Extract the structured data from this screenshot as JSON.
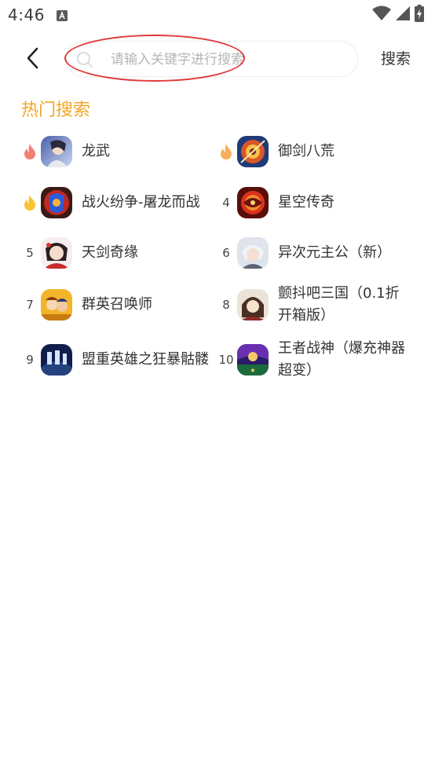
{
  "status": {
    "time": "4:46"
  },
  "search": {
    "placeholder": "请输入关键字进行搜索",
    "button_label": "搜索"
  },
  "hot_section": {
    "title": "热门搜索",
    "items": [
      {
        "rank": "",
        "rank_icon": "fire-icon-red",
        "name": "龙武"
      },
      {
        "rank": "",
        "rank_icon": "fire-icon-orange",
        "name": "御剑八荒"
      },
      {
        "rank": "",
        "rank_icon": "fire-icon-yellow",
        "name": "战火纷争-屠龙而战"
      },
      {
        "rank": "4",
        "rank_icon": "",
        "name": "星空传奇"
      },
      {
        "rank": "5",
        "rank_icon": "",
        "name": "天剑奇缘"
      },
      {
        "rank": "6",
        "rank_icon": "",
        "name": "异次元主公（新）"
      },
      {
        "rank": "7",
        "rank_icon": "",
        "name": "群英召唤师"
      },
      {
        "rank": "8",
        "rank_icon": "",
        "name": "颤抖吧三国（0.1折开箱版）"
      },
      {
        "rank": "9",
        "rank_icon": "",
        "name": "盟重英雄之狂暴骷髅"
      },
      {
        "rank": "10",
        "rank_icon": "",
        "name": "王者战神（爆充神器超变）"
      }
    ]
  },
  "colors": {
    "accent": "#f5a623",
    "highlight": "#e0393a",
    "fire_red": "#ef6a5a",
    "fire_orange": "#f5a13c",
    "fire_yellow": "#f7c531"
  }
}
